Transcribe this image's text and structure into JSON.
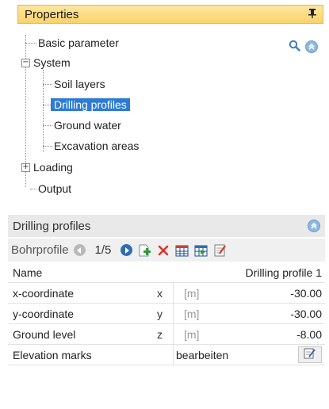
{
  "properties": {
    "title": "Properties",
    "pin_glyph": "Ԅ"
  },
  "tree": {
    "items": [
      {
        "label": "Basic parameter",
        "level": 0,
        "expander": ""
      },
      {
        "label": "System",
        "level": 0,
        "expander": "−"
      },
      {
        "label": "Soil layers",
        "level": 1,
        "expander": ""
      },
      {
        "label": "Drilling profiles",
        "level": 1,
        "expander": "",
        "selected": true
      },
      {
        "label": "Ground water",
        "level": 1,
        "expander": ""
      },
      {
        "label": "Excavation areas",
        "level": 1,
        "expander": ""
      },
      {
        "label": "Loading",
        "level": 0,
        "expander": "+"
      },
      {
        "label": "Output",
        "level": 0,
        "expander": ""
      }
    ]
  },
  "drilling_panel": {
    "title": "Drilling profiles",
    "toolbar": {
      "label": "Bohrprofile",
      "count": "1/5"
    },
    "rows": {
      "name": {
        "label": "Name",
        "value": "Drilling profile 1"
      },
      "x": {
        "label": "x-coordinate",
        "symbol": "x",
        "unit": "[m]",
        "value": "-30.00"
      },
      "y": {
        "label": "y-coordinate",
        "symbol": "y",
        "unit": "[m]",
        "value": "-30.00"
      },
      "z": {
        "label": "Ground level",
        "symbol": "z",
        "unit": "[m]",
        "value": "-8.00"
      },
      "elevation": {
        "label": "Elevation marks",
        "value": "bearbeiten"
      }
    }
  },
  "colors": {
    "header_yellow": "#fbd36c",
    "selection_blue": "#2d7bd4",
    "panel_gray": "#e9e9e9"
  }
}
